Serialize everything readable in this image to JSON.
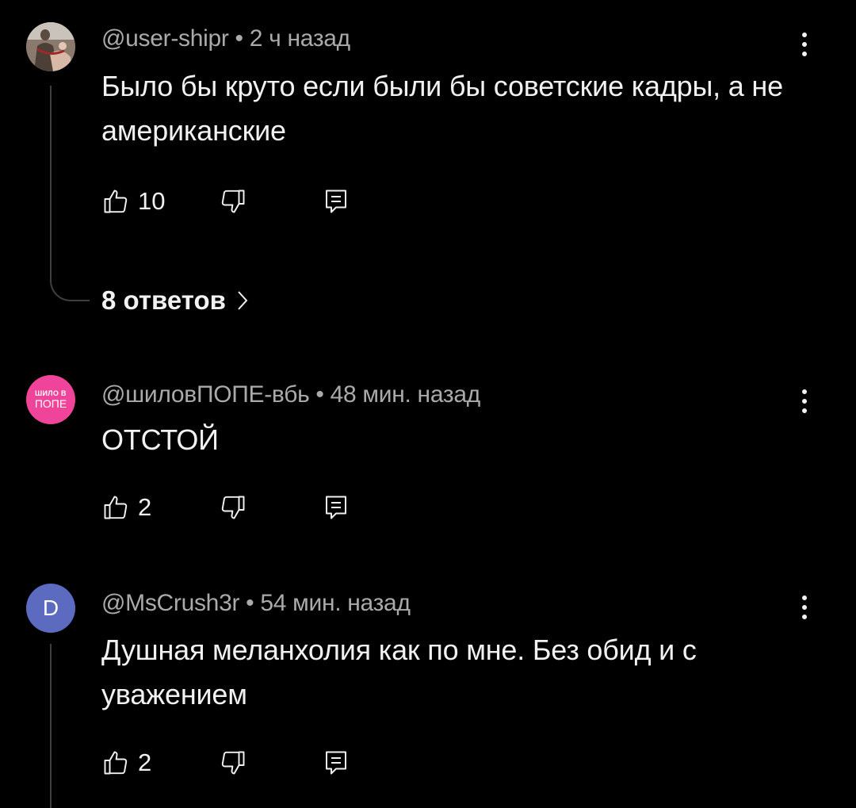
{
  "comments": [
    {
      "author": "@user-shipr",
      "time": "2 ч назад",
      "separator": "•",
      "text": "Было бы круто если были бы советские кадры, а не американские",
      "likes": "10",
      "avatar": {
        "type": "photo-icon"
      },
      "replies_label": "8 ответов"
    },
    {
      "author": "@шиловПОПЕ-вбь",
      "time": "48 мин. назад",
      "separator": "•",
      "text": "ОТСТОЙ",
      "likes": "2",
      "avatar": {
        "type": "logo",
        "line1": "ШИЛО В",
        "line2": "ПОПЕ",
        "bg": "#f0449a"
      }
    },
    {
      "author": "@MsCrush3r",
      "time": "54 мин. назад",
      "separator": "•",
      "text": "Душная меланхолия как по мне. Без обид и с уважением",
      "likes": "2",
      "avatar": {
        "type": "letter",
        "letter": "D",
        "bg": "#5c6bc0"
      }
    }
  ],
  "icons": {
    "like": "thumbs-up-icon",
    "dislike": "thumbs-down-icon",
    "reply": "reply-icon",
    "more": "more-vert-icon",
    "chevron": "chevron-right-icon"
  },
  "colors": {
    "background": "#000000",
    "text": "#f1f1f1",
    "meta": "#aaaaaa",
    "thread": "#3f3f3f"
  }
}
